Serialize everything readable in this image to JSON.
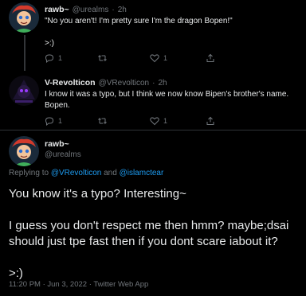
{
  "tweet1": {
    "author_name": "rawb~",
    "handle": "@urealms",
    "time": "2h",
    "text": "\"No you aren't! I'm pretty sure I'm the dragon Bopen!\"\n\n>:)",
    "reply_count": "1",
    "retweet_count": "",
    "like_count": "1"
  },
  "tweet2": {
    "author_name": "V-Revolticon",
    "handle": "@VRevolticon",
    "time": "2h",
    "text": "I know it was a typo, but I think we now know Bipen's brother's name.\nBopen.",
    "reply_count": "1",
    "retweet_count": "",
    "like_count": "1"
  },
  "main": {
    "author_name": "rawb~",
    "handle": "@urealms",
    "replying_prefix": "Replying to",
    "replying_user1": "@VRevolticon",
    "replying_and": "and",
    "replying_user2": "@islamctear",
    "text": "You know it's a typo? Interesting~\n\nI guess you don't respect me then hmm? maybe;dsai should just tpe fast then if you dont scare iabout it?\n\n>:)",
    "timestamp": "11:20 PM · Jun 3, 2022 · Twitter Web App"
  },
  "colors": {
    "background": "#000000",
    "text": "#e7e9ea",
    "secondary": "#71767b",
    "link": "#1d9bf0"
  }
}
